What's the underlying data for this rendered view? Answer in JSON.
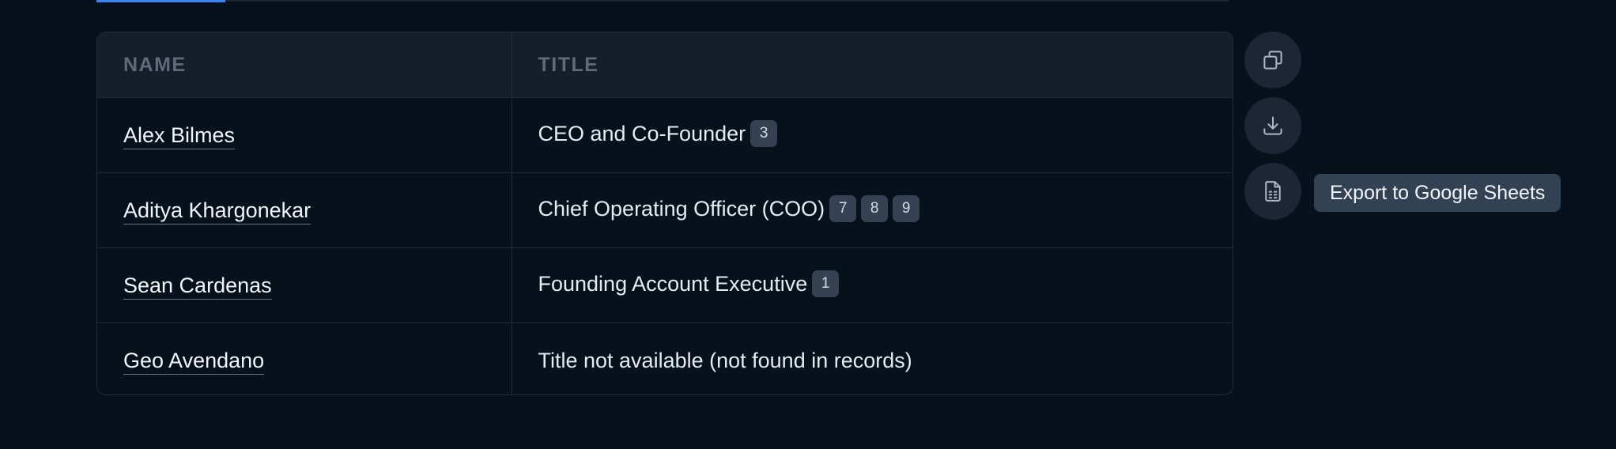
{
  "table": {
    "headers": {
      "name": "NAME",
      "title": "TITLE"
    },
    "rows": [
      {
        "name": "Alex Bilmes",
        "title": "CEO and Co-Founder",
        "citations": [
          "3"
        ]
      },
      {
        "name": "Aditya Khargonekar",
        "title": "Chief Operating Officer (COO)",
        "citations": [
          "7",
          "8",
          "9"
        ]
      },
      {
        "name": "Sean Cardenas",
        "title": "Founding Account Executive",
        "citations": [
          "1"
        ]
      },
      {
        "name": "Geo Avendano",
        "title": "Title not available (not found in records)",
        "citations": []
      }
    ]
  },
  "actions": {
    "copy_icon": "copy-icon",
    "download_icon": "download-icon",
    "sheets_icon": "spreadsheet-icon"
  },
  "tooltip": {
    "text": "Export to Google Sheets"
  },
  "colors": {
    "background": "#07111c",
    "header_bg": "#161e29",
    "badge_bg": "#364154",
    "accent": "#3b82f6"
  }
}
